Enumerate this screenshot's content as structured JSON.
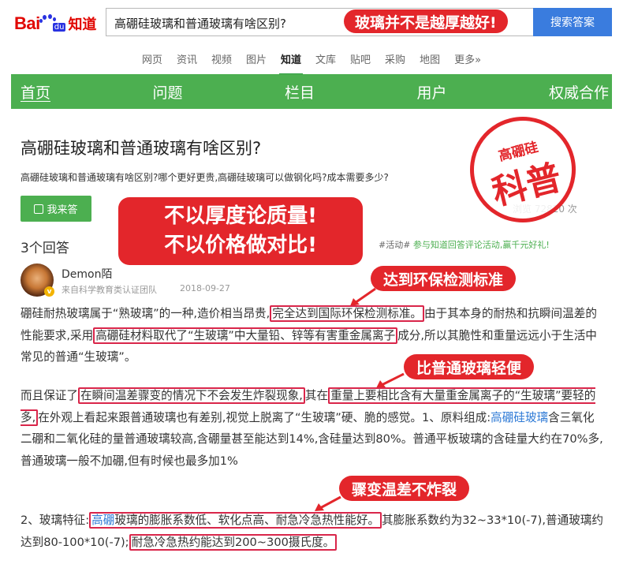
{
  "header": {
    "logo_bai": "Bai",
    "logo_du": "du",
    "logo_zhidao": "知道",
    "search_value": "高硼硅玻璃和普通玻璃有啥区别?",
    "search_button": "搜索答案",
    "tagline": "玻璃并不是越厚越好!"
  },
  "nav": [
    {
      "label": "网页"
    },
    {
      "label": "资讯"
    },
    {
      "label": "视频"
    },
    {
      "label": "图片"
    },
    {
      "label": "知道",
      "active": true
    },
    {
      "label": "文库"
    },
    {
      "label": "贴吧"
    },
    {
      "label": "采购"
    },
    {
      "label": "地图"
    },
    {
      "label": "更多»"
    }
  ],
  "greenbar": [
    "首页",
    "问题",
    "栏目",
    "用户",
    "权威合作"
  ],
  "question": {
    "title": "高硼硅玻璃和普通玻璃有啥区别?",
    "desc": "高硼硅玻璃和普通玻璃有啥区别?哪个更好更贵,高硼硅玻璃可以做钢化吗?成本需要多少?",
    "answer_button": "我来答",
    "views": "浏览 72820 次",
    "answer_count": "3个回答",
    "activity_tag": "#活动#",
    "activity_text": " 参与知道回答评论活动,赢千元好礼!"
  },
  "stamp": {
    "top": "高硼硅",
    "main": "科普"
  },
  "banner": {
    "line1": "不以厚度论质量!",
    "line2": "不以价格做对比!"
  },
  "author": {
    "name": "Demon陌",
    "team": "来自科学教育类认证团队",
    "date": "2018-09-27",
    "badge": "v"
  },
  "callouts": {
    "c1": "达到环保检测标准",
    "c2": "比普通玻璃轻便",
    "c3": "骤变温差不炸裂"
  },
  "body": {
    "p1a": "硼硅耐热玻璃属于“熟玻璃”的一种,造价相当昂贵,",
    "p1b": "完全达到国际环保检测标准。",
    "p1c": "由于其本身的耐热和抗瞬间温差的性能要求,采用",
    "p1d": "高硼硅材料取代了“生玻璃”中大量铅、锌等有害重金属离子",
    "p1e": "成分,所以其脆性和重量远远小于生活中常见的普通“生玻璃”。",
    "p2a": "而且保证了",
    "p2b": "在瞬间温差骤变的情况下不会发生炸裂现象,",
    "p2c": "其在",
    "p2d": "重量上要相比含有大量重金属离子的“生玻璃”要轻的多,",
    "p2e": "在外观上看起来跟普通玻璃也有差别,视觉上脱离了“生玻璃”硬、脆的感觉。1、原料组成:",
    "p2f": "高硼硅玻璃",
    "p2g": "含三氧化二硼和二氧化硅的量普通玻璃较高,含硼量甚至能达到14%,含硅量达到80%。普通平板玻璃的含硅量大约在70%多,普通玻璃一般不加硼,但有时候也最多加1%",
    "p3a": "2、玻璃特征:",
    "p3b": "高硼",
    "p3c": "玻璃的膨胀系数低、软化点高、耐急冷急热性能好。",
    "p3d": "其膨胀系数约为32~33*10(-7),普通玻璃约达到80-100*10(-7);",
    "p3e": "耐急冷急热约能达到200~300摄氏度。"
  }
}
